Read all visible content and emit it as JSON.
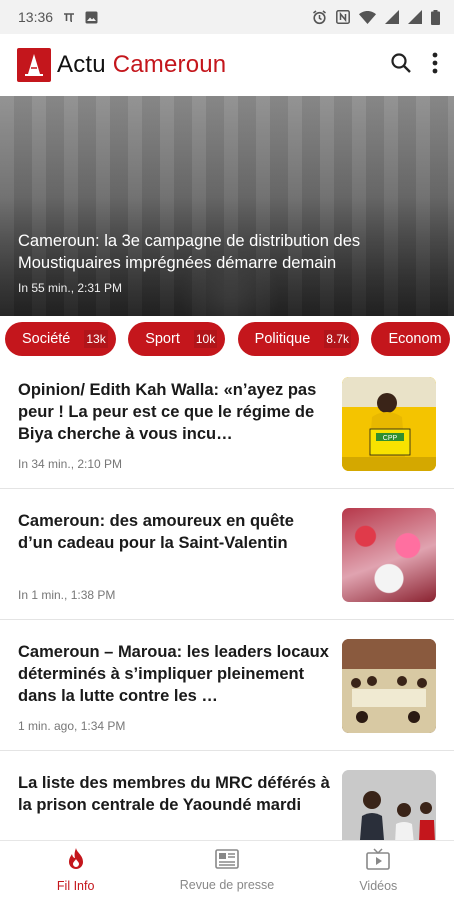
{
  "status_bar": {
    "time": "13:36",
    "icons": [
      "notification-pi-icon",
      "photo-icon",
      "alarm-icon",
      "nfc-icon",
      "wifi-icon",
      "signal-icon",
      "signal-icon",
      "battery-icon"
    ]
  },
  "app_bar": {
    "brand_part1": "Actu",
    "brand_part2": "Cameroun",
    "actions": [
      "search-icon",
      "more-vert-icon"
    ]
  },
  "colors": {
    "accent": "#c4161c",
    "text_primary": "#1a1a1a",
    "text_secondary": "#777777"
  },
  "hero": {
    "title": "Cameroun: la 3e campagne de distribution des Moustiquaires imprégnées démarre demain",
    "time": "In 55 min., 2:31 PM"
  },
  "categories": [
    {
      "label": "Société",
      "count": "13k"
    },
    {
      "label": "Sport",
      "count": "10k"
    },
    {
      "label": "Politique",
      "count": "8.7k"
    },
    {
      "label": "Econom",
      "count": ""
    }
  ],
  "articles": [
    {
      "headline": "Opinion/ Edith Kah Walla: «n’ayez pas peur ! La peur est ce que le régime de Biya cherche à vous incu…",
      "meta": "In 34 min., 2:10 PM",
      "thumb_sign": "CPP"
    },
    {
      "headline": "Cameroun: des amoureux en quête d’un cadeau pour la Saint-Valentin",
      "meta": "In 1 min., 1:38 PM"
    },
    {
      "headline": "Cameroun – Maroua: les leaders locaux déterminés à s’impliquer pleinement dans la lutte contre les …",
      "meta": "1 min. ago, 1:34 PM"
    },
    {
      "headline": "La liste des membres du MRC déférés à la prison centrale de Yaoundé mardi",
      "meta": ""
    }
  ],
  "bottom_nav": [
    {
      "label": "Fil Info",
      "icon": "flame-icon",
      "active": true
    },
    {
      "label": "Revue de presse",
      "icon": "newspaper-icon",
      "active": false
    },
    {
      "label": "Vidéos",
      "icon": "video-tv-icon",
      "active": false
    }
  ]
}
